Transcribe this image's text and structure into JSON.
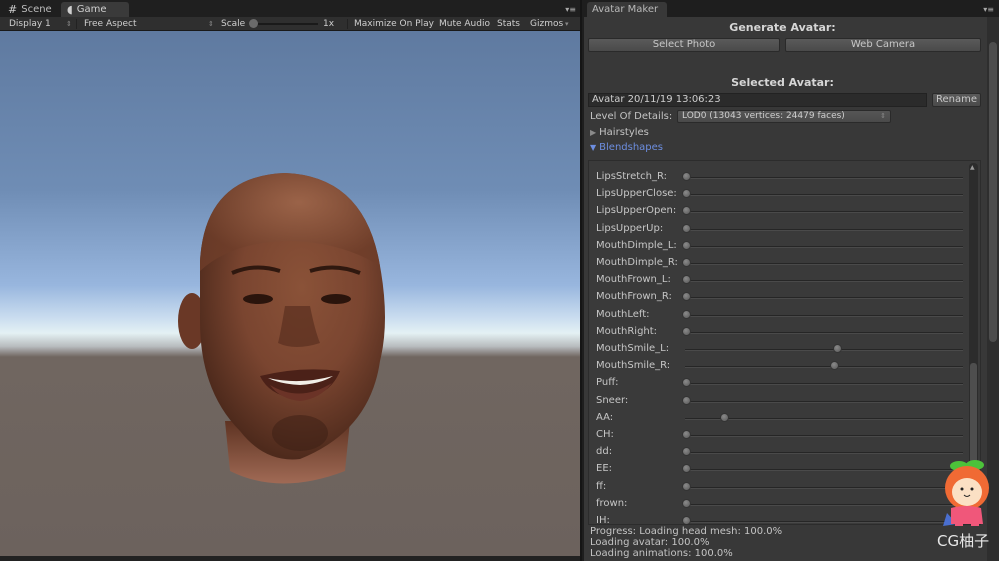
{
  "game_window": {
    "tabs": [
      {
        "label": "Scene",
        "icon": "grid-icon",
        "active": false
      },
      {
        "label": "Game",
        "icon": "pacman-icon",
        "active": true
      }
    ],
    "toolbar": {
      "display": "Display 1",
      "aspect": "Free Aspect",
      "scale_label": "Scale",
      "scale_value": "1x",
      "maximize_on_play": "Maximize On Play",
      "mute_audio": "Mute Audio",
      "stats": "Stats",
      "gizmos": "Gizmos"
    },
    "scene": {
      "subject": "3D generated avatar head",
      "sky_color": "#7f9dc6",
      "ground_color": "#6c625d"
    }
  },
  "avatar_maker": {
    "tab_label": "Avatar Maker",
    "generate_title": "Generate Avatar:",
    "select_photo_label": "Select Photo",
    "web_camera_label": "Web Camera",
    "selected_title": "Selected Avatar:",
    "avatar_name": "Avatar 20/11/19 13:06:23",
    "rename_label": "Rename",
    "lod_label": "Level Of Details:",
    "lod_value": "LOD0 (13043 vertices: 24479 faces)",
    "hairstyles_label": "Hairstyles",
    "hairstyles_expanded": false,
    "blendshapes_label": "Blendshapes",
    "blendshapes_expanded": true,
    "blendshapes": [
      {
        "name": "LipsStretch_R:",
        "value": 0.0
      },
      {
        "name": "LipsUpperClose:",
        "value": 0.0
      },
      {
        "name": "LipsUpperOpen:",
        "value": 0.0
      },
      {
        "name": "LipsUpperUp:",
        "value": 0.0
      },
      {
        "name": "MouthDimple_L:",
        "value": 0.0
      },
      {
        "name": "MouthDimple_R:",
        "value": 0.0
      },
      {
        "name": "MouthFrown_L:",
        "value": 0.0
      },
      {
        "name": "MouthFrown_R:",
        "value": 0.0
      },
      {
        "name": "MouthLeft:",
        "value": 0.0
      },
      {
        "name": "MouthRight:",
        "value": 0.0
      },
      {
        "name": "MouthSmile_L:",
        "value": 0.56
      },
      {
        "name": "MouthSmile_R:",
        "value": 0.55
      },
      {
        "name": "Puff:",
        "value": 0.0
      },
      {
        "name": "Sneer:",
        "value": 0.0
      },
      {
        "name": "AA:",
        "value": 0.14
      },
      {
        "name": "CH:",
        "value": 0.0
      },
      {
        "name": "dd:",
        "value": 0.0
      },
      {
        "name": "EE:",
        "value": 0.0
      },
      {
        "name": "ff:",
        "value": 0.0
      },
      {
        "name": "frown:",
        "value": 0.0
      },
      {
        "name": "IH:",
        "value": 0.0
      }
    ],
    "progress_lines": [
      "Progress: Loading head mesh: 100.0%",
      "Loading avatar: 100.0%",
      "Loading animations: 100.0%"
    ]
  },
  "watermark": {
    "text": "CG柚子"
  }
}
